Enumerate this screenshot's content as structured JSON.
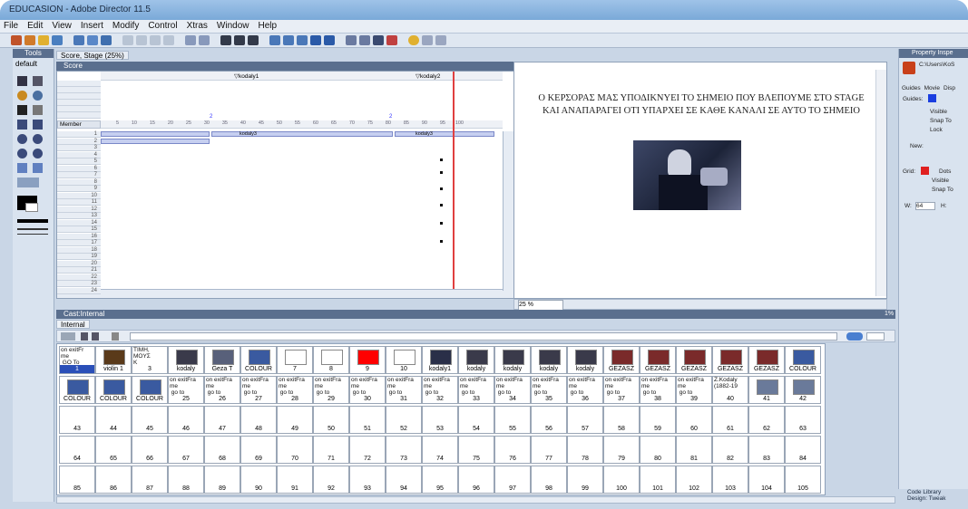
{
  "app": {
    "title": "EDUCASION - Adobe Director 11.5"
  },
  "menu": [
    "File",
    "Edit",
    "View",
    "Insert",
    "Modify",
    "Control",
    "Xtras",
    "Window",
    "Help"
  ],
  "tools_panel": {
    "title": "Tools",
    "preset": "default"
  },
  "stage_tab": "Score, Stage (25%)",
  "score": {
    "title": "Score",
    "markers": [
      "▽kodaly1",
      "▽kodaly2"
    ],
    "member_label": "Member",
    "sprite_labels": [
      "kodaly3",
      "kodaly3"
    ],
    "frame_ticks": [
      "5",
      "10",
      "15",
      "20",
      "25",
      "30",
      "35",
      "40",
      "45",
      "50",
      "55",
      "60",
      "65",
      "70",
      "75",
      "80",
      "85",
      "90",
      "95",
      "100"
    ]
  },
  "stage": {
    "line1": "Ο ΚΕΡΣΟΡΑΣ ΜΑΣ ΥΠΟΔΙΚΝΥΕΙ ΤΟ ΣΗΜΕΙΟ ΠΟΥ ΒΛΕΠΟΥΜΕ ΣΤΟ STAGE",
    "line2": "ΚΑΙ ΑΝΑΠΑΡΑΓΕΙ ΟΤΙ ΥΠΑΡΧΕΙ ΣΕ ΚΑΘΕ ΚΑΝΑΛΙ ΣΕ ΑΥΤΟ ΤΟ ΣΗΜΕΙΟ",
    "zoom": "25 %"
  },
  "property_inspector": {
    "title": "Property Inspe",
    "path": "C:\\Users\\KoS",
    "tabs": [
      "Guides",
      "Movie",
      "Disp"
    ],
    "guides_label": "Guides:",
    "visible": "Visible",
    "snap_to": "Snap To",
    "lock": "Lock",
    "new_label": "New:",
    "grid_label": "Grid:",
    "dots": "Dots",
    "visible2": "Visible",
    "snap_to2": "Snap To",
    "w_label": "W:",
    "w_value": "64",
    "h_label": "H:"
  },
  "cast": {
    "title": "Cast:Internal",
    "tab": "Internal",
    "pct": "1%",
    "rows": [
      [
        {
          "n": "1",
          "t": "on exitFr\nme\n GO To"
        },
        {
          "n": "violin 1",
          "t": ""
        },
        {
          "n": "3",
          "t": "TIMH,\nMOYΣ\nK"
        },
        {
          "n": "kodaly",
          "t": ""
        },
        {
          "n": "Geza T",
          "t": ""
        },
        {
          "n": "COLOUR",
          "t": ""
        },
        {
          "n": "7",
          "t": ""
        },
        {
          "n": "8",
          "t": ""
        },
        {
          "n": "9",
          "t": ""
        },
        {
          "n": "10",
          "t": ""
        },
        {
          "n": "kodaly1",
          "t": ""
        },
        {
          "n": "kodaly",
          "t": ""
        },
        {
          "n": "kodaly",
          "t": ""
        },
        {
          "n": "kodaly",
          "t": ""
        },
        {
          "n": "kodaly",
          "t": ""
        },
        {
          "n": "GEZASZ",
          "t": ""
        },
        {
          "n": "GEZASZ",
          "t": ""
        },
        {
          "n": "GEZASZ",
          "t": ""
        },
        {
          "n": "GEZASZ",
          "t": ""
        },
        {
          "n": "GEZASZ",
          "t": ""
        },
        {
          "n": "COLOUR",
          "t": ""
        }
      ],
      [
        {
          "n": "COLOUR",
          "t": ""
        },
        {
          "n": "COLOUR",
          "t": ""
        },
        {
          "n": "COLOUR",
          "t": ""
        },
        {
          "n": "25",
          "t": "on exitFra\nme\n go to"
        },
        {
          "n": "26",
          "t": "on exitFra\nme\n go to"
        },
        {
          "n": "27",
          "t": "on exitFra\nme\n go to"
        },
        {
          "n": "28",
          "t": "on exitFra\nme\n go to"
        },
        {
          "n": "29",
          "t": "on exitFra\nme\n go to"
        },
        {
          "n": "30",
          "t": "on exitFra\nme\n go to"
        },
        {
          "n": "31",
          "t": "on exitFra\nme\n go to"
        },
        {
          "n": "32",
          "t": "on exitFra\nme\n go to"
        },
        {
          "n": "33",
          "t": "on exitFra\nme\n go to"
        },
        {
          "n": "34",
          "t": "on exitFra\nme\n go to"
        },
        {
          "n": "35",
          "t": "on exitFra\nme\n go to"
        },
        {
          "n": "36",
          "t": "on exitFra\nme\n go to"
        },
        {
          "n": "37",
          "t": "on exitFra\nme\n go to"
        },
        {
          "n": "38",
          "t": "on exitFra\nme\n go to"
        },
        {
          "n": "39",
          "t": "on exitFra\nme\n go to"
        },
        {
          "n": "40",
          "t": "Z.Kodaly\n(1882-19"
        },
        {
          "n": "41",
          "t": ""
        },
        {
          "n": "42",
          "t": ""
        }
      ],
      [
        {
          "n": "43"
        },
        {
          "n": "44"
        },
        {
          "n": "45"
        },
        {
          "n": "46"
        },
        {
          "n": "47"
        },
        {
          "n": "48"
        },
        {
          "n": "49"
        },
        {
          "n": "50"
        },
        {
          "n": "51"
        },
        {
          "n": "52"
        },
        {
          "n": "53"
        },
        {
          "n": "54"
        },
        {
          "n": "55"
        },
        {
          "n": "56"
        },
        {
          "n": "57"
        },
        {
          "n": "58"
        },
        {
          "n": "59"
        },
        {
          "n": "60"
        },
        {
          "n": "61"
        },
        {
          "n": "62"
        },
        {
          "n": "63"
        }
      ],
      [
        {
          "n": "64"
        },
        {
          "n": "65"
        },
        {
          "n": "66"
        },
        {
          "n": "67"
        },
        {
          "n": "68"
        },
        {
          "n": "69"
        },
        {
          "n": "70"
        },
        {
          "n": "71"
        },
        {
          "n": "72"
        },
        {
          "n": "73"
        },
        {
          "n": "74"
        },
        {
          "n": "75"
        },
        {
          "n": "76"
        },
        {
          "n": "77"
        },
        {
          "n": "78"
        },
        {
          "n": "79"
        },
        {
          "n": "80"
        },
        {
          "n": "81"
        },
        {
          "n": "82"
        },
        {
          "n": "83"
        },
        {
          "n": "84"
        }
      ],
      [
        {
          "n": "85"
        },
        {
          "n": "86"
        },
        {
          "n": "87"
        },
        {
          "n": "88"
        },
        {
          "n": "89"
        },
        {
          "n": "90"
        },
        {
          "n": "91"
        },
        {
          "n": "92"
        },
        {
          "n": "93"
        },
        {
          "n": "94"
        },
        {
          "n": "95"
        },
        {
          "n": "96"
        },
        {
          "n": "97"
        },
        {
          "n": "98"
        },
        {
          "n": "99"
        },
        {
          "n": "100"
        },
        {
          "n": "101"
        },
        {
          "n": "102"
        },
        {
          "n": "103"
        },
        {
          "n": "104"
        },
        {
          "n": "105"
        }
      ]
    ]
  },
  "bottom_panels": [
    "Code Library",
    "Design: Tweak"
  ]
}
